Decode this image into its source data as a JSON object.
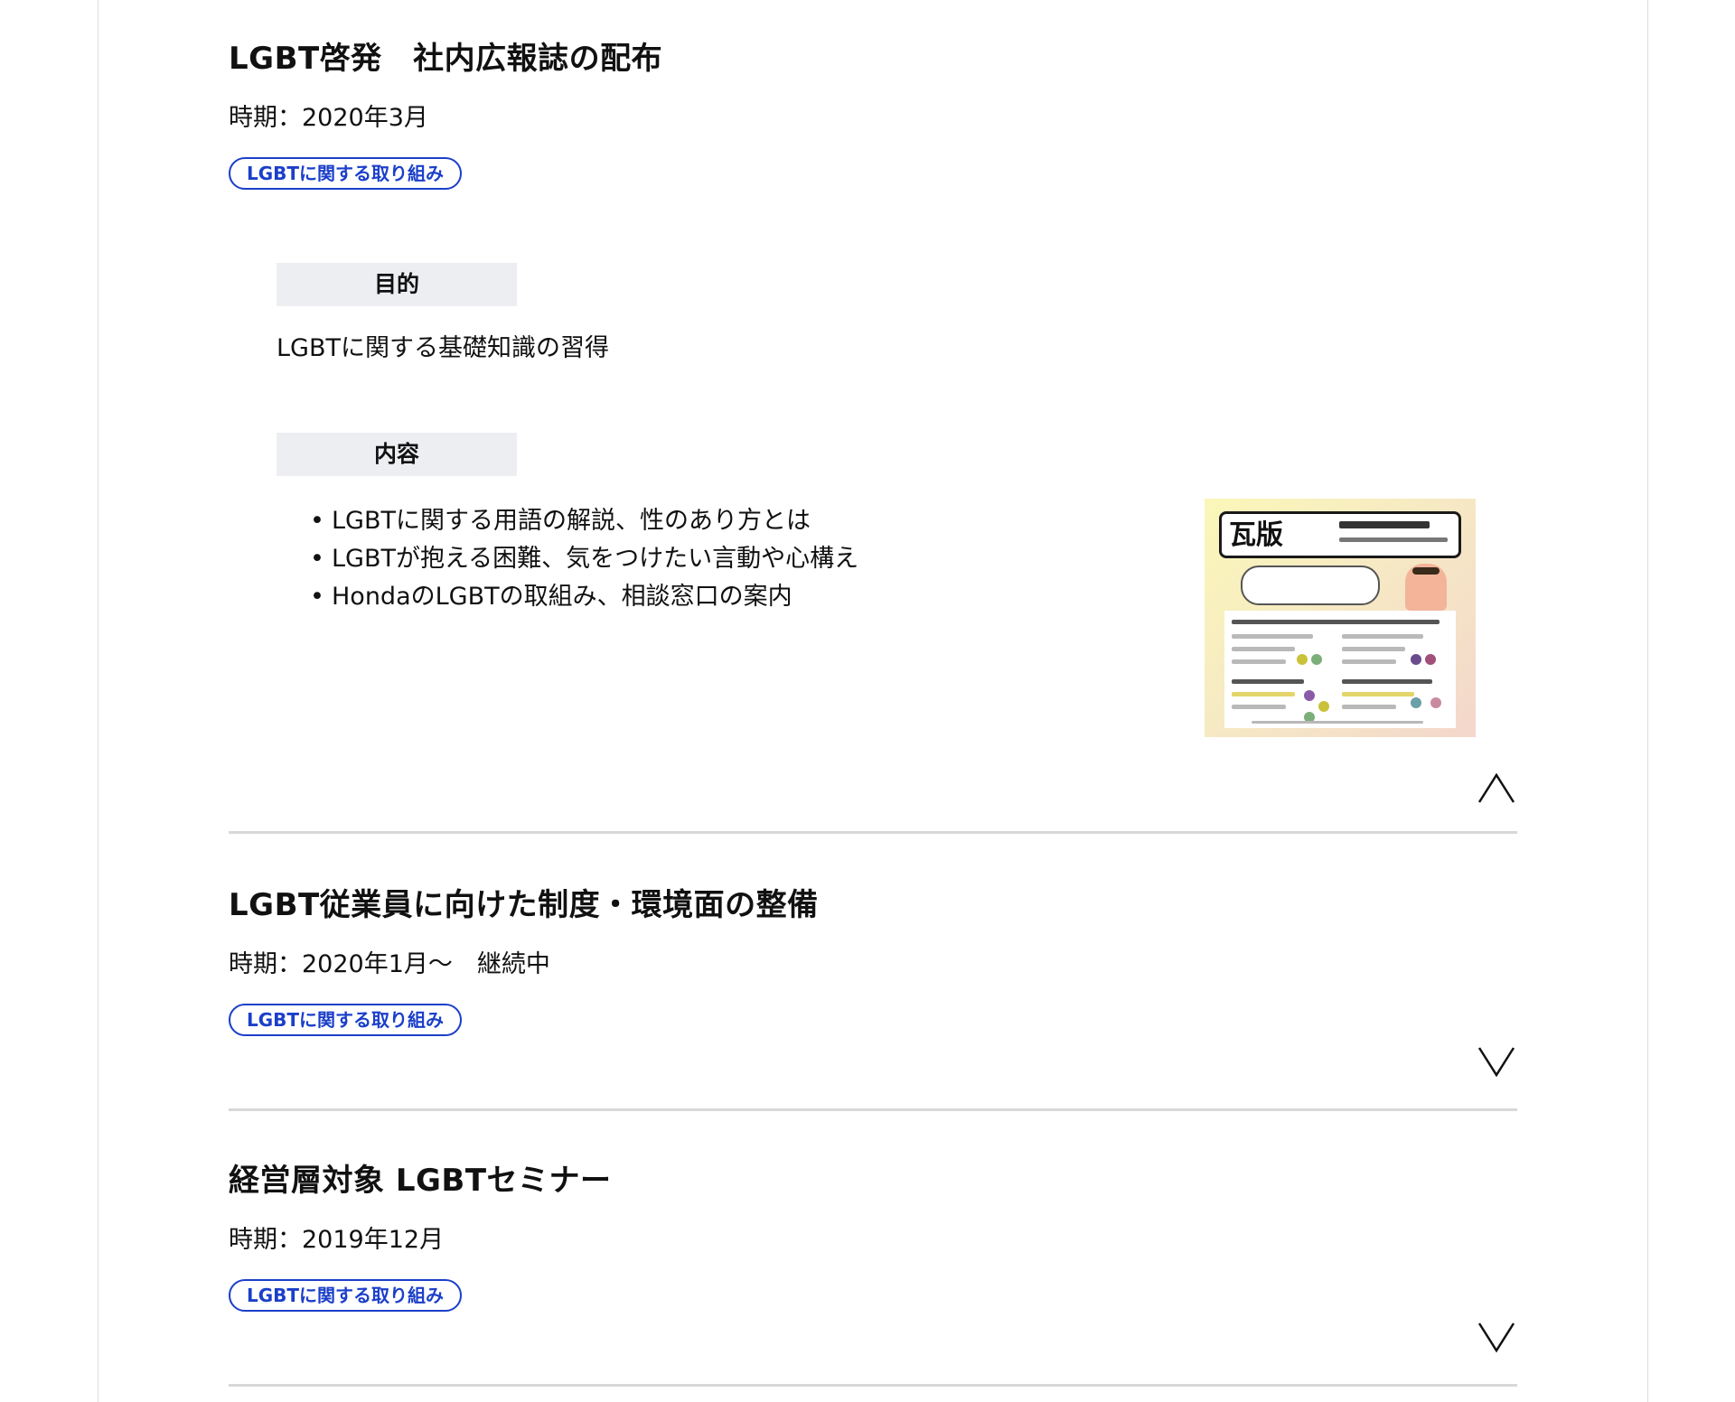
{
  "entries": [
    {
      "title": "LGBT啓発　社内広報誌の配布",
      "period": "時期：2020年3月",
      "tag": "LGBTに関する取り組み",
      "expanded": true,
      "purpose_label": "目的",
      "purpose_text": "LGBTに関する基礎知識の習得",
      "content_label": "内容",
      "content_items": [
        "LGBTに関する用語の解説、性のあり方とは",
        "LGBTが抱える困難、気をつけたい言動や心構え",
        "HondaのLGBTの取組み、相談窓口の案内"
      ],
      "thumbnail": {
        "heading": "瓦版",
        "colors": {
          "top": "#fbf7b9",
          "bottom": "#f4d7cc"
        }
      },
      "toggle_icon": "chevron-up-icon"
    },
    {
      "title": "LGBT従業員に向けた制度・環境面の整備",
      "period": "時期：2020年1月〜　継続中",
      "tag": "LGBTに関する取り組み",
      "expanded": false,
      "toggle_icon": "chevron-down-icon"
    },
    {
      "title": "経営層対象 LGBTセミナー",
      "period": "時期：2019年12月",
      "tag": "LGBTに関する取り組み",
      "expanded": false,
      "toggle_icon": "chevron-down-icon"
    }
  ],
  "colors": {
    "tag_blue": "#1b3fc9",
    "label_bg": "#eceef2",
    "divider": "#d8d8d8",
    "text": "#111111"
  }
}
